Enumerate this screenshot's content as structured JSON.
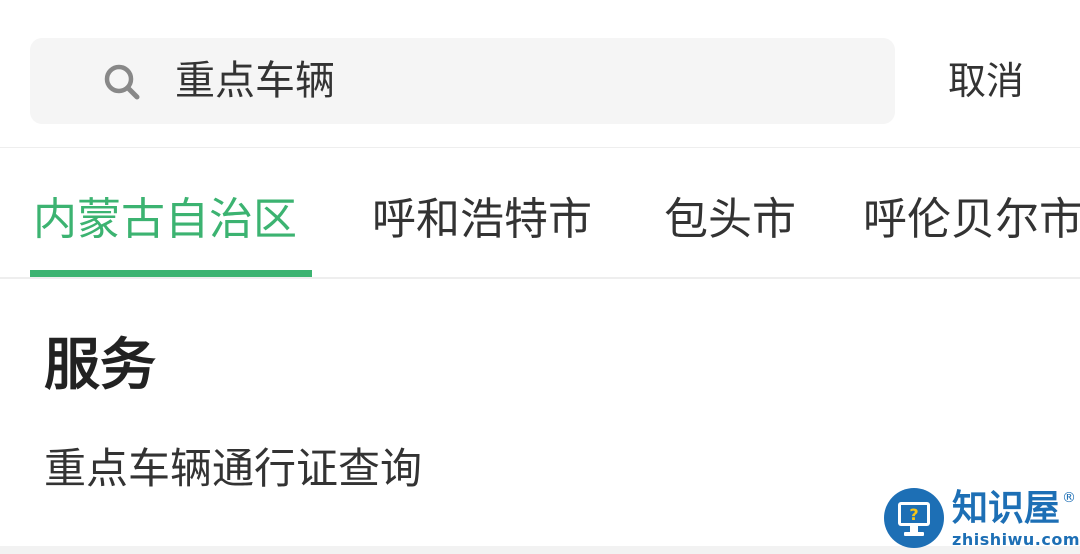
{
  "search": {
    "value": "重点车辆",
    "icon": "search-icon"
  },
  "header": {
    "cancel_label": "取消"
  },
  "tabs": [
    {
      "label": "内蒙古自治区",
      "active": true
    },
    {
      "label": "呼和浩特市",
      "active": false
    },
    {
      "label": "包头市",
      "active": false
    },
    {
      "label": "呼伦贝尔市",
      "active": false
    }
  ],
  "section": {
    "title": "服务",
    "items": [
      {
        "label": "重点车辆通行证查询"
      }
    ]
  },
  "watermark": {
    "name": "知识屋",
    "domain": "zhishiwu.com",
    "registered": "®"
  },
  "colors": {
    "accent": "#3cb371",
    "text": "#333333",
    "search_bg": "#f5f5f5",
    "watermark": "#1d6fb5"
  }
}
